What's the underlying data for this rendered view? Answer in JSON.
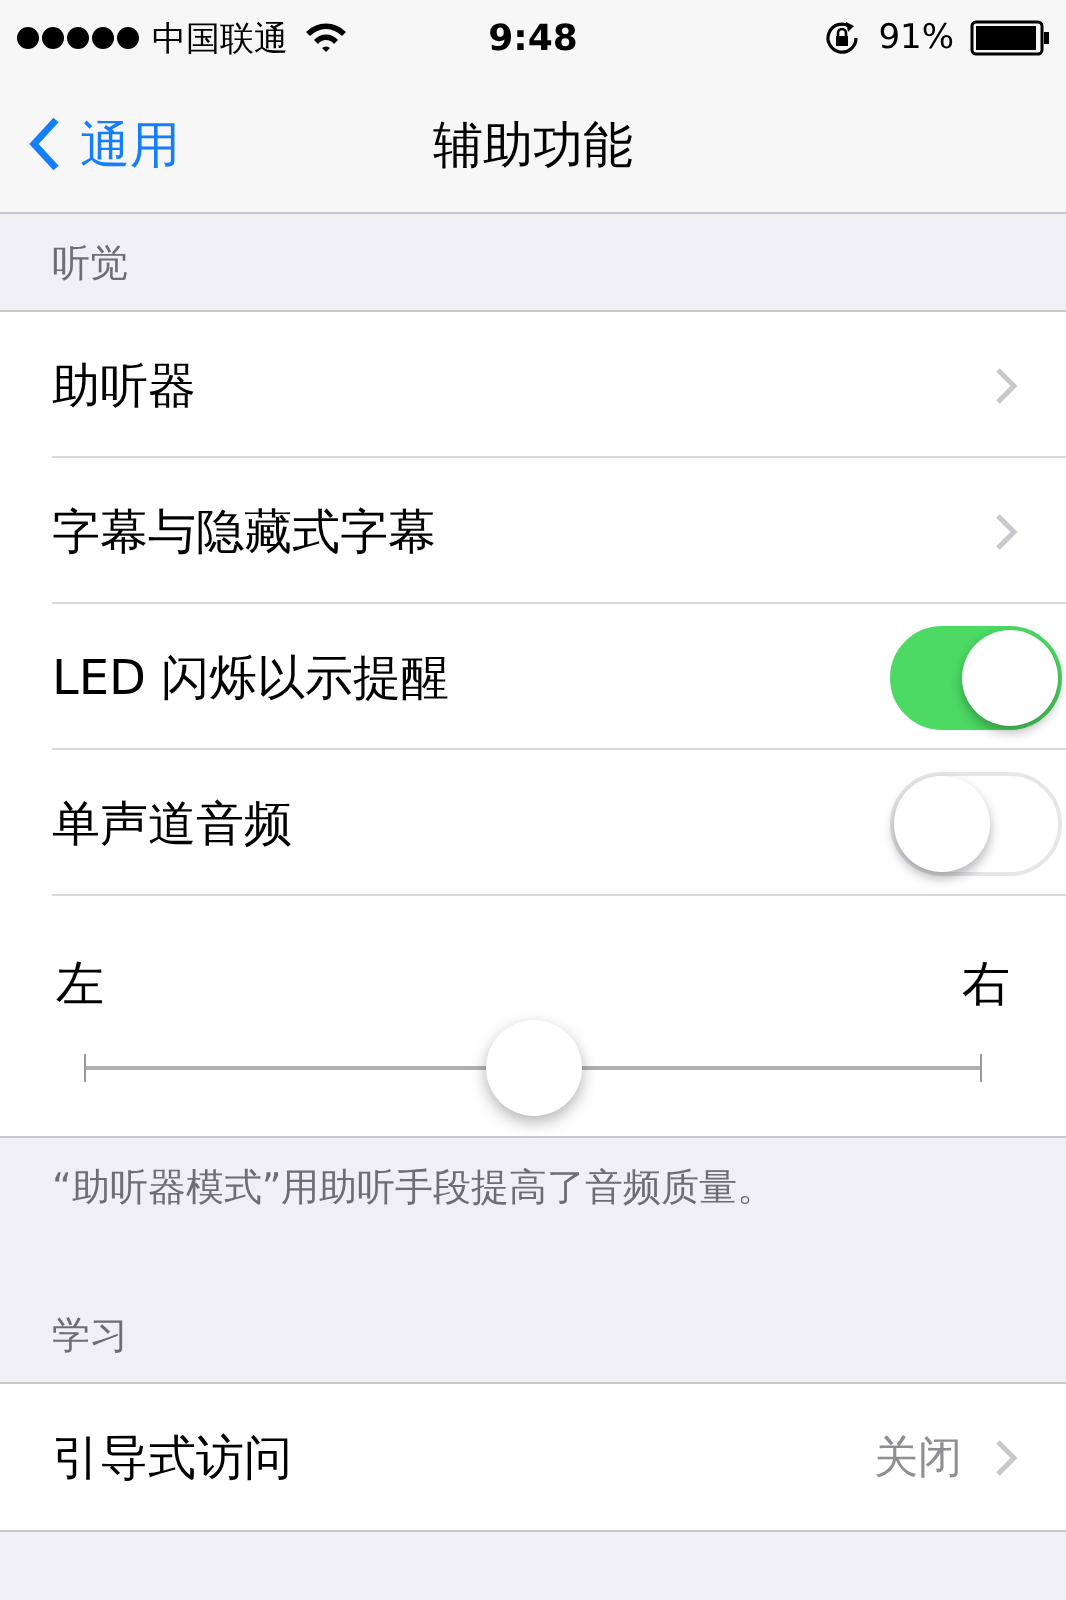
{
  "status_bar": {
    "carrier": "中国联通",
    "time": "9:48",
    "battery": "91%"
  },
  "nav": {
    "back": "通用",
    "title": "辅助功能"
  },
  "sections": [
    {
      "header": "听觉",
      "rows": [
        {
          "kind": "link",
          "label": "助听器"
        },
        {
          "kind": "link",
          "label": "字幕与隐藏式字幕"
        },
        {
          "kind": "toggle",
          "label": "LED 闪烁以示提醒",
          "on": true
        },
        {
          "kind": "toggle",
          "label": "单声道音频",
          "on": false
        },
        {
          "kind": "balance",
          "left": "左",
          "right": "右",
          "level": 0.5
        }
      ],
      "footer": "“助听器模式”用助听手段提高了音频质量。"
    },
    {
      "header": "学习",
      "rows": [
        {
          "kind": "link",
          "label": "引导式访问",
          "value": "关闭"
        }
      ]
    }
  ]
}
